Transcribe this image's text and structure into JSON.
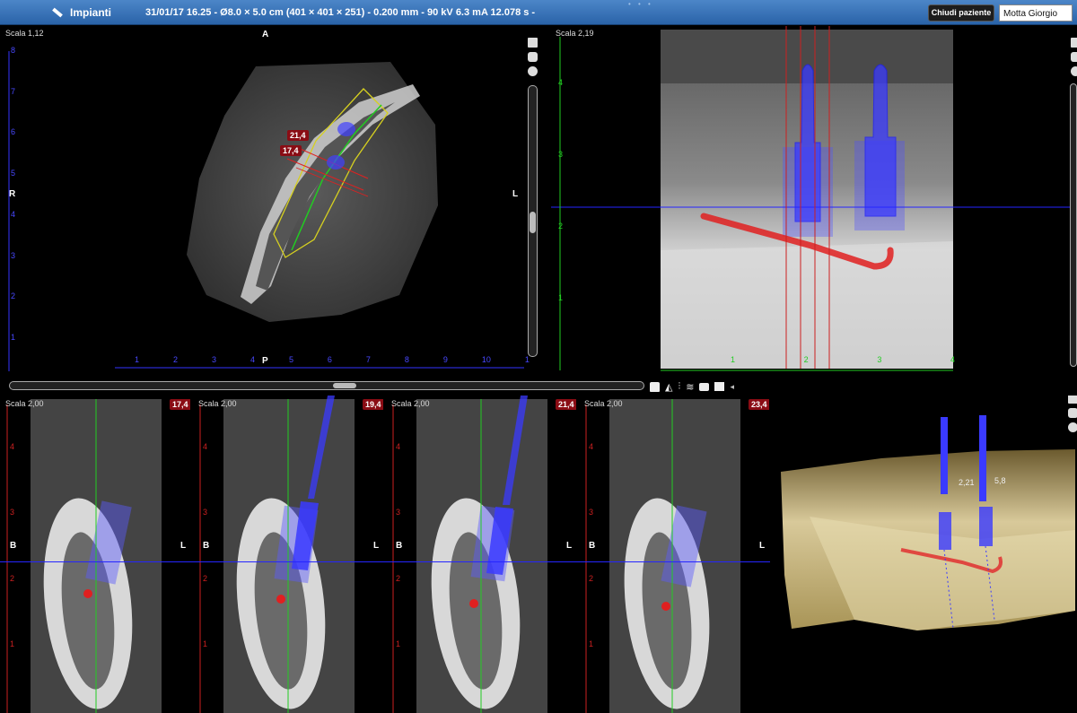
{
  "toolbar": {
    "title": "Impianti",
    "info": "31/01/17 16.25 - Ø8.0 × 5.0 cm (401 × 401 × 251) - 0.200 mm - 90 kV 6.3 mA 12.078 s -",
    "close_patient_label": "Chiudi paziente",
    "patient_name": "Motta Giorgio"
  },
  "axial": {
    "scale": "Scala 1,12",
    "top": "A",
    "bottom": "P",
    "left": "R",
    "right": "L",
    "label_a": "21,4",
    "label_b": "17,4",
    "ruler_x": [
      "1",
      "2",
      "3",
      "4",
      "5",
      "6",
      "7",
      "8",
      "9",
      "10",
      "1"
    ],
    "ruler_y": [
      "8",
      "7",
      "6",
      "5",
      "4",
      "3",
      "2",
      "1"
    ]
  },
  "panoramic": {
    "scale": "Scala 2,19",
    "ruler_y": [
      "4",
      "3",
      "2",
      "1"
    ],
    "ruler_x": [
      "1",
      "2",
      "3",
      "4"
    ]
  },
  "cross_sections": [
    {
      "scale": "Scala 2,00",
      "badge": "17,4",
      "left": "B",
      "right": "L"
    },
    {
      "scale": "Scala 2,00",
      "badge": "19,4",
      "left": "B",
      "right": "L"
    },
    {
      "scale": "Scala 2,00",
      "badge": "21,4",
      "left": "B",
      "right": "L"
    },
    {
      "scale": "Scala 2,00",
      "badge": "23,4",
      "left": "B",
      "right": "L"
    }
  ],
  "cross_ruler": [
    "4",
    "3",
    "2",
    "1"
  ],
  "render3d": {
    "label_a": "2,21",
    "label_b": "5,8"
  },
  "icons": {
    "toolbar": [
      "measure-icon",
      "window-icon",
      "camera-icon",
      "tools-icon"
    ],
    "view_tools": [
      "lock-icon",
      "flip-icon",
      "implant-icon",
      "nerve-icon",
      "camera-icon",
      "window-icon",
      "collapse-icon"
    ]
  },
  "colors": {
    "implant": "#3a3aff",
    "nerve": "#e02020",
    "reference_line": "#22cc22",
    "topbar": "#2f6bb2"
  }
}
